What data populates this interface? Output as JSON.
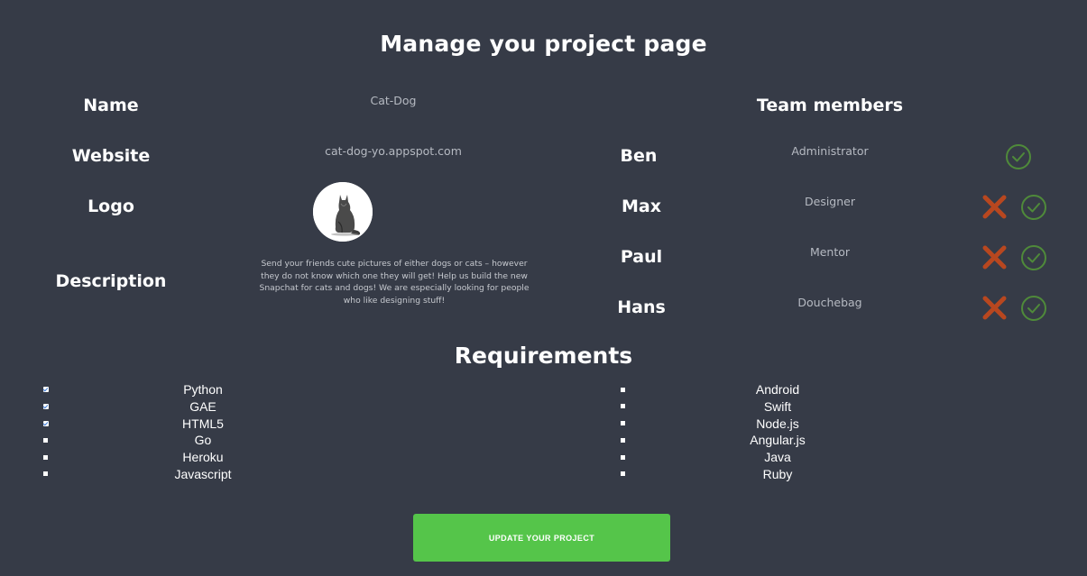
{
  "page": {
    "title": "Manage you project page"
  },
  "project": {
    "name_label": "Name",
    "name_value": "Cat-Dog",
    "website_label": "Website",
    "website_value": "cat-dog-yo.appspot.com",
    "logo_label": "Logo",
    "description_label": "Description",
    "description_value": "Send your friends cute pictures of either dogs or cats – however they do not know which one they will get! Help us build the new Snapchat for cats and dogs! We are especially looking for people who like designing stuff!"
  },
  "team": {
    "title": "Team members",
    "members": [
      {
        "name": "Ben",
        "role": "Administrator"
      },
      {
        "name": "Max",
        "role": "Designer"
      },
      {
        "name": "Paul",
        "role": "Mentor"
      },
      {
        "name": "Hans",
        "role": "Douchebag"
      }
    ]
  },
  "requirements": {
    "title": "Requirements",
    "left": [
      {
        "label": "Python",
        "checked": true
      },
      {
        "label": "GAE",
        "checked": true
      },
      {
        "label": "HTML5",
        "checked": true
      },
      {
        "label": "Go",
        "checked": false
      },
      {
        "label": "Heroku",
        "checked": false
      },
      {
        "label": "Javascript",
        "checked": false
      }
    ],
    "right": [
      {
        "label": "Android",
        "checked": false
      },
      {
        "label": "Swift",
        "checked": false
      },
      {
        "label": "Node.js",
        "checked": false
      },
      {
        "label": "Angular.js",
        "checked": false
      },
      {
        "label": "Java",
        "checked": false
      },
      {
        "label": "Ruby",
        "checked": false
      }
    ]
  },
  "actions": {
    "update_label": "UPDATE YOUR PROJECT"
  },
  "icons": {
    "approve": "check-circle-icon",
    "remove": "x-cross-icon",
    "logo": "cat-icon"
  },
  "colors": {
    "background": "#363b47",
    "approve": "#4f8a3a",
    "remove": "#b8471f",
    "button": "#55c54a"
  }
}
